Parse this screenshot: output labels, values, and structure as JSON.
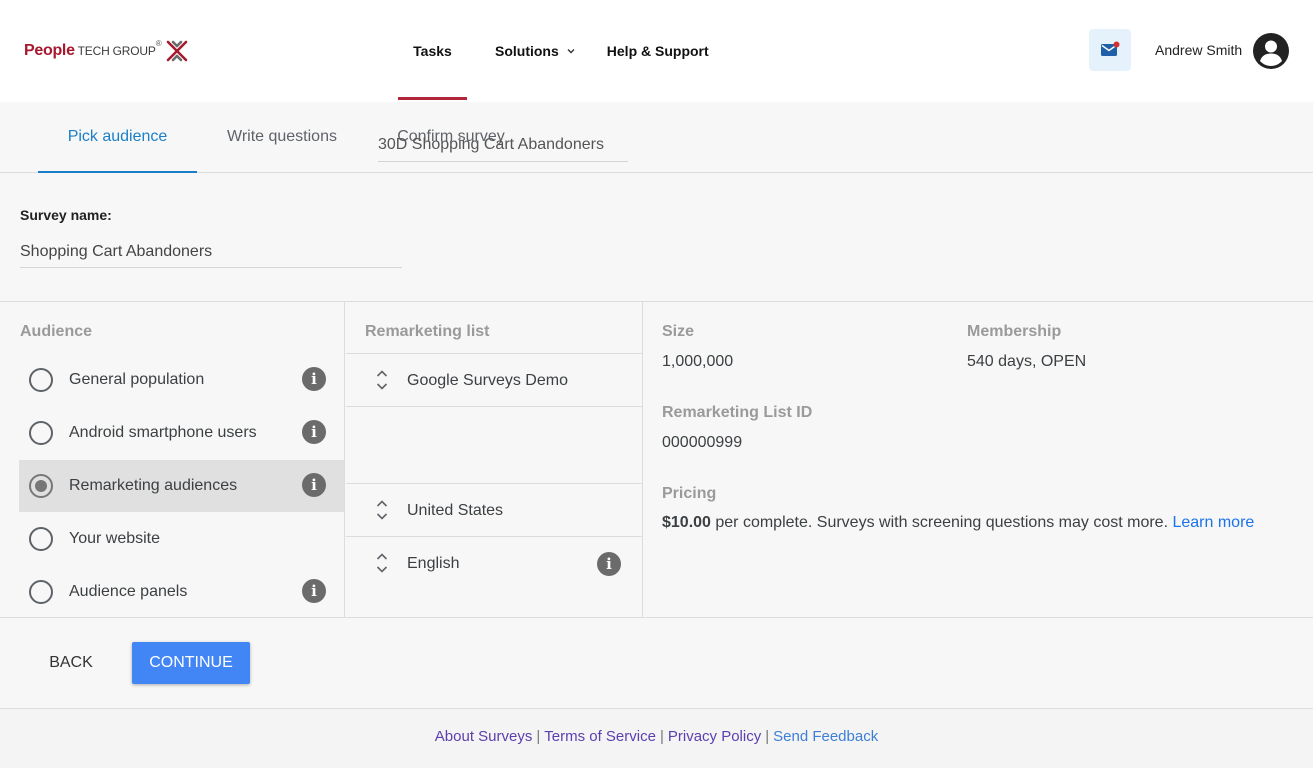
{
  "brand": {
    "name_part1": "People",
    "name_part2": "TECH GROUP",
    "registered": "®",
    "accent": "#a6192e"
  },
  "nav": {
    "items": [
      {
        "label": "Tasks",
        "active": true
      },
      {
        "label": "Solutions",
        "has_dropdown": true
      },
      {
        "label": "Help & Support"
      }
    ]
  },
  "user": {
    "name": "Andrew Smith",
    "icons": [
      "mail-icon",
      "account-circle-icon"
    ]
  },
  "steps": [
    "Pick audience",
    "Write questions",
    "Confirm survey"
  ],
  "active_step": "Pick audience",
  "survey": {
    "label": "Survey name:",
    "value": "Shopping Cart Abandoners"
  },
  "audience": {
    "title": "Audience",
    "options": [
      {
        "label": "General population",
        "selected": false,
        "info": true
      },
      {
        "label": "Android smartphone users",
        "selected": false,
        "info": true
      },
      {
        "label": "Remarketing audiences",
        "selected": true,
        "info": true
      },
      {
        "label": "Your website",
        "selected": false,
        "info": false
      },
      {
        "label": "Audience panels",
        "selected": false,
        "info": true
      }
    ]
  },
  "remarketing": {
    "title": "Remarketing list",
    "account": "Google Surveys Demo",
    "list_value": "30D Shopping Cart Abandoners",
    "country": "United States",
    "language": "English"
  },
  "details": {
    "size_label": "Size",
    "size_value": "1,000,000",
    "membership_label": "Membership",
    "membership_value": "540 days, OPEN",
    "list_id_label": "Remarketing List ID",
    "list_id_value": "000000999",
    "pricing_label": "Pricing",
    "price": "$10.00",
    "pricing_text": " per complete. Surveys with screening questions may cost more. ",
    "learn_more": "Learn more"
  },
  "actions": {
    "back": "BACK",
    "continue": "CONTINUE"
  },
  "footer": {
    "links": [
      "About Surveys",
      "Terms of Service",
      "Privacy Policy",
      "Send Feedback"
    ],
    "separator": "|"
  },
  "colors": {
    "primary": "#4285f4",
    "tab_active": "#1a7fc8",
    "nav_underline": "#b0263a",
    "link": "#1a73e8"
  }
}
